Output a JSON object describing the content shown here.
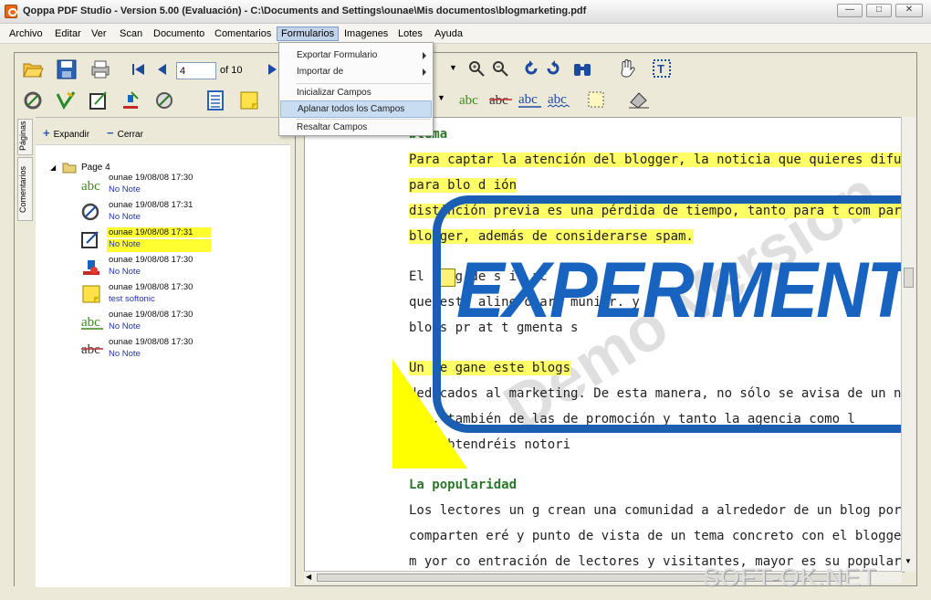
{
  "title": "Qoppa PDF Studio - Version 5.00 (Evaluación) - C:\\Documents and Settings\\ounae\\Mis documentos\\blogmarketing.pdf",
  "menu": [
    "Archivo",
    "Editar",
    "Ver",
    "Scan",
    "Documento",
    "Comentarios",
    "Formularios",
    "Imagenes",
    "Lotes",
    "Ayuda"
  ],
  "formularios_menu": {
    "exportar": "Exportar Formulario",
    "importar": "Importar de",
    "inicializar": "Inicializar Campos",
    "aplanar": "Aplanar todos los Campos",
    "resaltar": "Resaltar Campos"
  },
  "navigation": {
    "page": "4",
    "of": "of 10"
  },
  "tree": {
    "expandir": "Expandir",
    "cerrar": "Cerrar",
    "page": "Page 4",
    "tab_paginas": "Páginas",
    "tab_comentarios": "Comentarios",
    "annotations": [
      {
        "meta": "ounae 19/08/08 17:30",
        "note": "No Note",
        "icon": "highlight-text-icon"
      },
      {
        "meta": "ounae 19/08/08 17:31",
        "note": "No Note",
        "icon": "circle-icon"
      },
      {
        "meta": "ounae 19/08/08 17:31",
        "note": "No Note",
        "icon": "text-box-icon"
      },
      {
        "meta": "ounae 19/08/08 17:30",
        "note": "No Note",
        "icon": "stamp-icon"
      },
      {
        "meta": "ounae 19/08/08 17:30",
        "note": "test softonic",
        "icon": "sticky-note-icon"
      },
      {
        "meta": "ounae 19/08/08 17:30",
        "note": "No Note",
        "icon": "underline-text-icon"
      },
      {
        "meta": "ounae 19/08/08 17:30",
        "note": "No Note",
        "icon": "strikeout-text-icon"
      }
    ]
  },
  "document": {
    "heading1": "blema",
    "lines1": [
      "Para captar la atención del blogger, la noticia que quieres difundir   exc",
      "para        blo         d      ión      ",
      "distinción previa es una pérdida de tiempo, tanto para t  com   par   el",
      "blogger, además de considerarse spam."
    ],
    "lines2": [
      "El              blog   de                   s                   ir ac",
      "que esté   aline        o        arg                         munidr.   y",
      "blogs pr   at          t                             gmenta      s"
    ],
    "lines3": [
      "Un  te             gane                        este    blogs",
      "dedicados al marketing. De esta manera, no sólo se avisa de un nuevo",
      "        cto, también de las             de promoción y tanto la agencia como l",
      "        esa obtendréis notori"
    ],
    "heading2": "La popularidad",
    "lines4": [
      "Los lectores   un   g crean una comunidad a alrededor de un blog porqu",
      "comparten    eré  y punto de vista de un tema concreto con el blogger. A",
      "m yor co   entración de lectores y visitantes, mayor es su popularidad."
    ],
    "experimental": "EXPERIMENTAL",
    "demo": "Demo Version"
  },
  "watermark": "SOFT-OK.NET"
}
